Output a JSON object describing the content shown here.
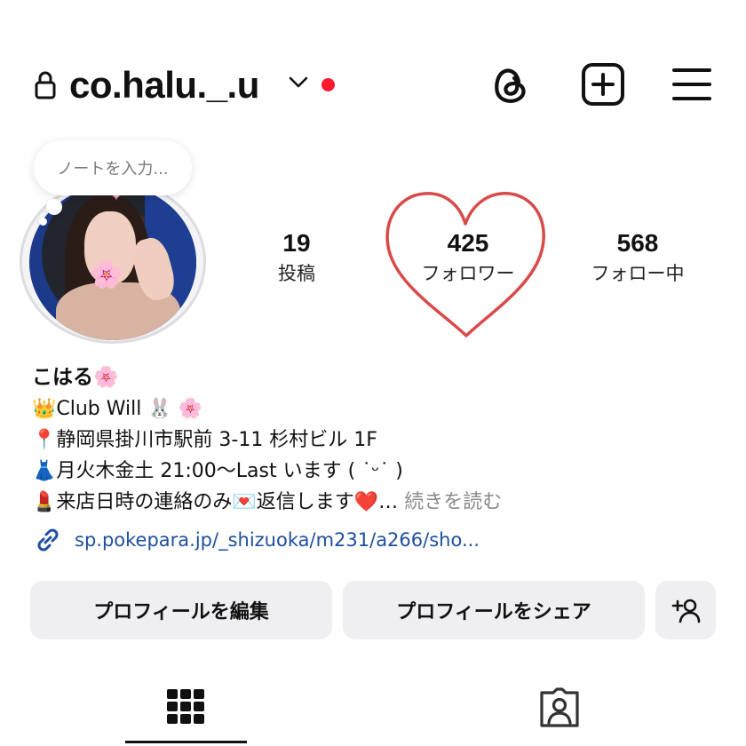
{
  "header": {
    "username": "co.halu._.u",
    "icons": [
      "lock-icon",
      "chevron-down-icon",
      "threads-icon",
      "create-plus-icon",
      "menu-icon"
    ],
    "notification_dot_color": "#ff1a2e"
  },
  "note": {
    "placeholder": "ノートを入力..."
  },
  "stats": {
    "posts": {
      "count": "19",
      "label": "投稿"
    },
    "followers": {
      "count": "425",
      "label": "フォロワー"
    },
    "following": {
      "count": "568",
      "label": "フォロー中"
    }
  },
  "bio": {
    "name": "こはる🌸",
    "line1": "👑Club Will 🐰 🌸",
    "line2": "📍静岡県掛川市駅前 3-11 杉村ビル 1F",
    "line3": "👗月火木金土 21:00～Last います ( ˙ᵕ˙ )",
    "line4": "💄来店日時の連絡のみ💌返信します❤️…",
    "more": "続きを読む"
  },
  "link": {
    "text": "sp.pokepara.jp/_shizuoka/m231/a266/sho..."
  },
  "buttons": {
    "edit": "プロフィールを編集",
    "share": "プロフィールをシェア"
  },
  "tabs": {
    "active": "grid",
    "icons": [
      "grid-icon",
      "tagged-icon"
    ]
  },
  "colors": {
    "link": "#1f4fa0",
    "heart_annotation": "#d94a4a",
    "button_bg": "#efeff1"
  }
}
